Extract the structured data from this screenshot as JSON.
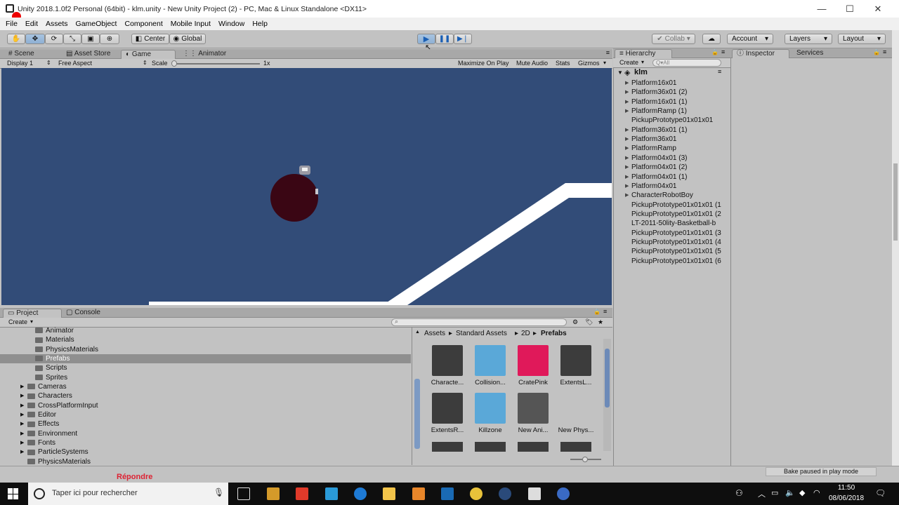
{
  "window": {
    "title": "Unity 2018.1.0f2 Personal (64bit) - klm.unity - New Unity Project (2) - PC, Mac & Linux Standalone <DX11>",
    "minimize": "—",
    "maximize": "☐",
    "close": "✕"
  },
  "menu": [
    "File",
    "Edit",
    "Assets",
    "GameObject",
    "Component",
    "Mobile Input",
    "Window",
    "Help"
  ],
  "toolbar": {
    "center": "Center",
    "global": "Global",
    "collab": "Collab ▾",
    "account": "Account",
    "layers": "Layers",
    "layout": "Layout"
  },
  "scene_tabs": {
    "scene": "Scene",
    "asset_store": "Asset Store",
    "game": "Game",
    "animator": "Animator"
  },
  "game_bar": {
    "display": "Display 1",
    "aspect": "Free Aspect",
    "scale_label": "Scale",
    "scale_value": "1x",
    "maximize": "Maximize On Play",
    "mute": "Mute Audio",
    "stats": "Stats",
    "gizmos": "Gizmos"
  },
  "hierarchy": {
    "tab": "Hierarchy",
    "create": "Create",
    "search_placeholder": "Q▾All",
    "scene": "klm",
    "items": [
      {
        "label": "Platform16x01",
        "arrow": true
      },
      {
        "label": "Platform36x01 (2)",
        "arrow": true
      },
      {
        "label": "Platform16x01 (1)",
        "arrow": true
      },
      {
        "label": "PlatformRamp (1)",
        "arrow": true
      },
      {
        "label": "PickupPrototype01x01x01",
        "arrow": false
      },
      {
        "label": "Platform36x01 (1)",
        "arrow": true
      },
      {
        "label": "Platform36x01",
        "arrow": true
      },
      {
        "label": "PlatformRamp",
        "arrow": true
      },
      {
        "label": "Platform04x01 (3)",
        "arrow": true
      },
      {
        "label": "Platform04x01 (2)",
        "arrow": true
      },
      {
        "label": "Platform04x01 (1)",
        "arrow": true
      },
      {
        "label": "Platform04x01",
        "arrow": true
      },
      {
        "label": "CharacterRobotBoy",
        "arrow": true
      },
      {
        "label": "PickupPrototype01x01x01 (1",
        "arrow": false
      },
      {
        "label": "PickupPrototype01x01x01 (2",
        "arrow": false
      },
      {
        "label": "LT-2011-50lity-Basketball-b",
        "arrow": false
      },
      {
        "label": "PickupPrototype01x01x01 (3",
        "arrow": false
      },
      {
        "label": "PickupPrototype01x01x01 (4",
        "arrow": false
      },
      {
        "label": "PickupPrototype01x01x01 (5",
        "arrow": false
      },
      {
        "label": "PickupPrototype01x01x01 (6",
        "arrow": false
      }
    ]
  },
  "inspector": {
    "tab": "Inspector",
    "services": "Services"
  },
  "project": {
    "tab": "Project",
    "console": "Console",
    "create": "Create",
    "tree_sub": [
      "Animator",
      "Materials",
      "PhysicsMaterials",
      "Prefabs",
      "Scripts",
      "Sprites"
    ],
    "tree_top": [
      "Cameras",
      "Characters",
      "CrossPlatformInput",
      "Editor",
      "Effects",
      "Environment",
      "Fonts",
      "ParticleSystems",
      "PhysicsMaterials"
    ],
    "breadcrumb": [
      "Assets",
      "Standard Assets",
      "2D",
      "Prefabs"
    ],
    "assets": [
      {
        "label": "Characte...",
        "color": "#3c3c3c"
      },
      {
        "label": "Collision...",
        "color": "#5aa8d8"
      },
      {
        "label": "CratePink",
        "color": "#e0195a"
      },
      {
        "label": "ExtentsL...",
        "color": "#3c3c3c"
      },
      {
        "label": "ExtentsR...",
        "color": "#3c3c3c"
      },
      {
        "label": "Killzone",
        "color": "#5aa8d8"
      },
      {
        "label": "New Ani...",
        "color": "#555555"
      },
      {
        "label": "New Phys...",
        "color": "#c2c2c2"
      }
    ]
  },
  "status": {
    "bake": "Bake paused in play mode"
  },
  "taskbar": {
    "search": "Taper ici pour rechercher",
    "time": "11:50",
    "date": "08/06/2018",
    "partial": "Répondre"
  }
}
